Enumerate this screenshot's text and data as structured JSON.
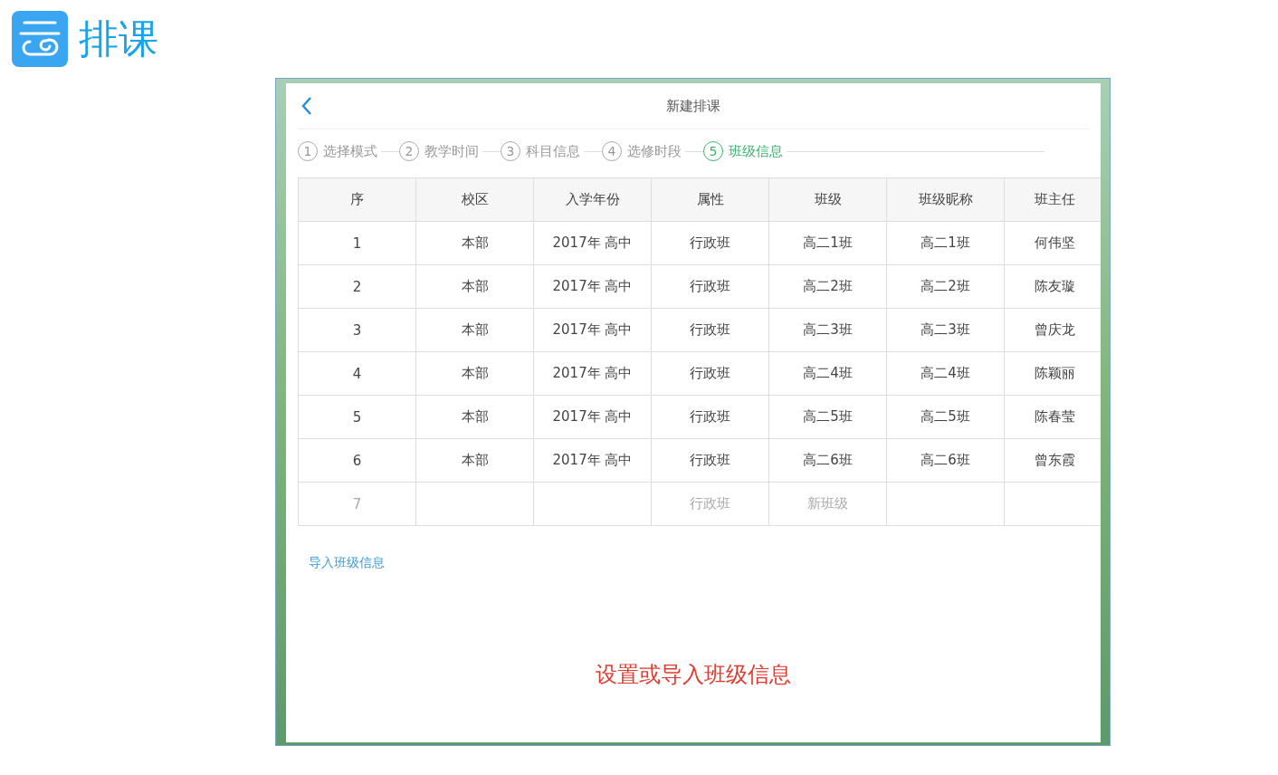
{
  "app": {
    "title": "排课"
  },
  "dialog": {
    "title": "新建排课"
  },
  "steps": [
    {
      "number": "1",
      "label": "选择模式",
      "selected": false
    },
    {
      "number": "2",
      "label": "教学时间",
      "selected": false
    },
    {
      "number": "3",
      "label": "科目信息",
      "selected": false
    },
    {
      "number": "4",
      "label": "选修时段",
      "selected": false
    },
    {
      "number": "5",
      "label": "班级信息",
      "selected": true
    }
  ],
  "table": {
    "columns": [
      "序",
      "校区",
      "入学年份",
      "属性",
      "班级",
      "班级昵称",
      "班主任"
    ],
    "rows": [
      {
        "kind": "data",
        "cells": [
          "1",
          "本部",
          "2017年 高中",
          "行政班",
          "高二1班",
          "高二1班",
          "何伟坚"
        ]
      },
      {
        "kind": "data",
        "cells": [
          "2",
          "本部",
          "2017年 高中",
          "行政班",
          "高二2班",
          "高二2班",
          "陈友璇"
        ]
      },
      {
        "kind": "data",
        "cells": [
          "3",
          "本部",
          "2017年 高中",
          "行政班",
          "高二3班",
          "高二3班",
          "曾庆龙"
        ]
      },
      {
        "kind": "data",
        "cells": [
          "4",
          "本部",
          "2017年 高中",
          "行政班",
          "高二4班",
          "高二4班",
          "陈颖丽"
        ]
      },
      {
        "kind": "data",
        "cells": [
          "5",
          "本部",
          "2017年 高中",
          "行政班",
          "高二5班",
          "高二5班",
          "陈春莹"
        ]
      },
      {
        "kind": "data",
        "cells": [
          "6",
          "本部",
          "2017年 高中",
          "行政班",
          "高二6班",
          "高二6班",
          "曾东霞"
        ]
      },
      {
        "kind": "new",
        "cells": [
          "7",
          "",
          "",
          "行政班",
          "新班级",
          "",
          ""
        ]
      }
    ]
  },
  "import_link": "导入班级信息",
  "caption": "设置或导入班级信息"
}
